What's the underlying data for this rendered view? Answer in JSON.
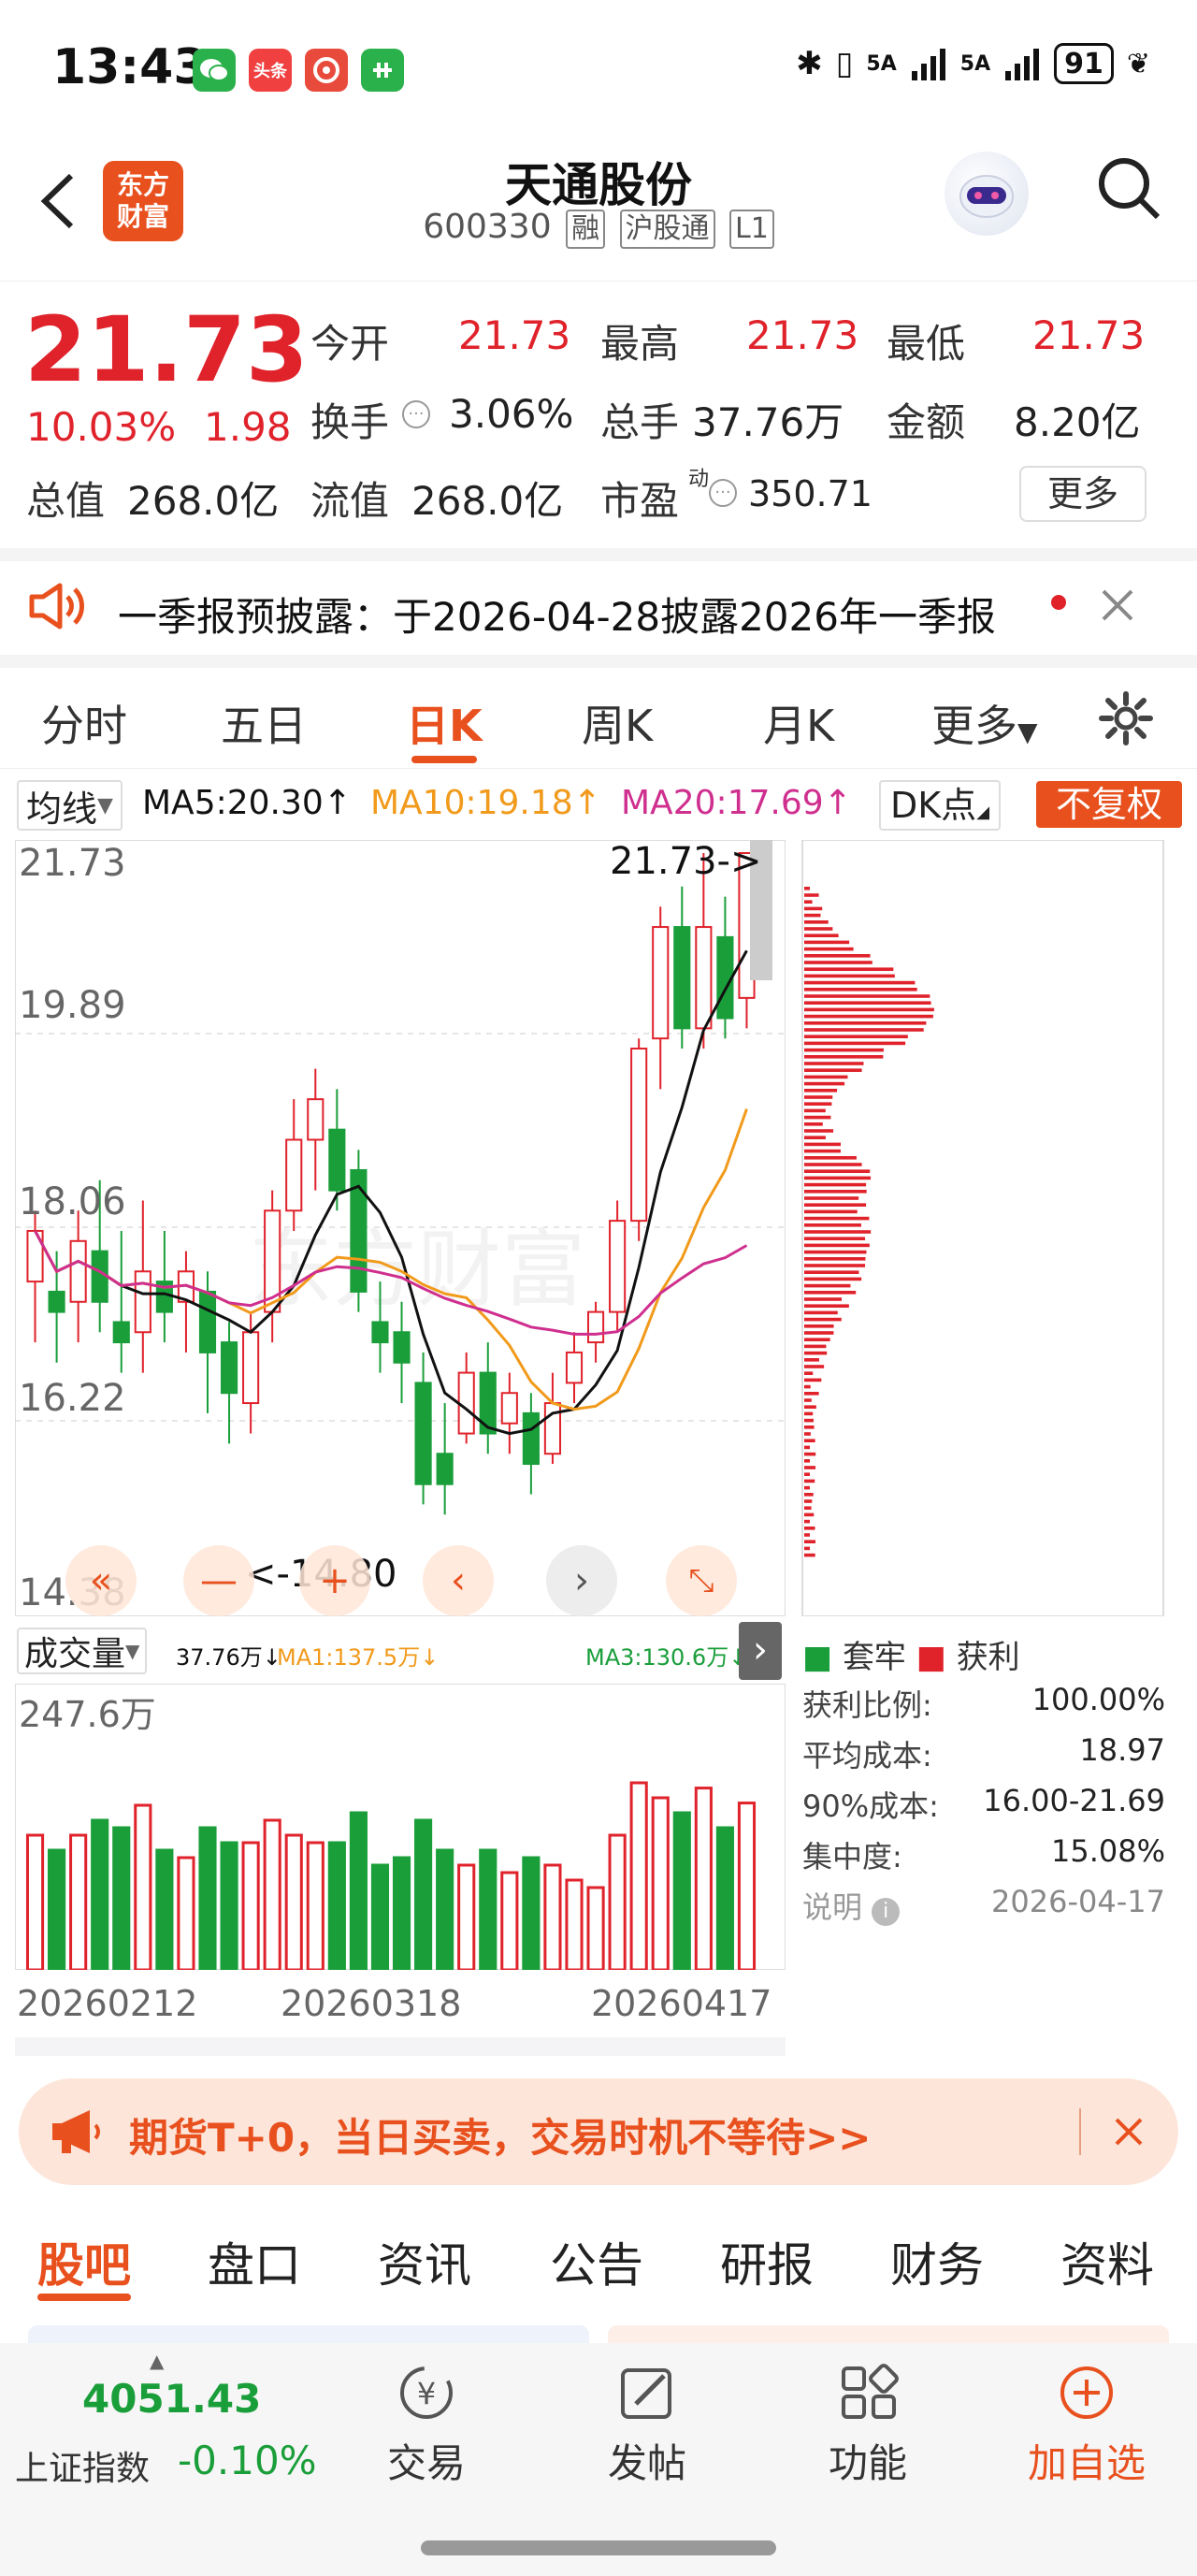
{
  "status": {
    "time": "13:43",
    "app_icons": [
      "wechat-icon",
      "toutiao-icon",
      "app-icon",
      "app-icon-2"
    ],
    "toutiao_text": "头条",
    "battery": "91",
    "signal1": "5A",
    "signal2": "5A"
  },
  "header": {
    "logo_text_line1": "东方",
    "logo_text_line2": "财富",
    "stock_name": "天通股份",
    "stock_code": "600330",
    "tag_rong": "融",
    "tag_hgt": "沪股通",
    "tag_l1": "L1"
  },
  "quote": {
    "price": "21.73",
    "change_pct": "10.03%",
    "change_amt": "1.98",
    "open_label": "今开",
    "open": "21.73",
    "high_label": "最高",
    "high": "21.73",
    "low_label": "最低",
    "low": "21.73",
    "turnover_label": "换手",
    "turnover": "3.06%",
    "volume_label": "总手",
    "volume": "37.76万",
    "amount_label": "金额",
    "amount": "8.20亿",
    "total_mv_label": "总值",
    "total_mv": "268.0亿",
    "float_mv_label": "流值",
    "float_mv": "268.0亿",
    "pe_label": "市盈",
    "pe_sup": "动",
    "pe": "350.71",
    "more_button": "更多"
  },
  "notice": {
    "text": "一季报预披露：于2026-04-28披露2026年一季报"
  },
  "tabs": [
    "分时",
    "五日",
    "日K",
    "周K",
    "月K",
    "更多"
  ],
  "active_tab": "日K",
  "ma_legend": {
    "ma_select": "均线",
    "ma5": "MA5:20.30",
    "ma10": "MA10:19.18",
    "ma20": "MA20:17.69",
    "dk": "DK点",
    "fuquan": "不复权"
  },
  "chart_labels": {
    "y1": "21.73",
    "y2": "19.89",
    "y3": "18.06",
    "y4": "16.22",
    "y5": "14.38",
    "last_price_marker": "21.73->",
    "min_marker": "<-14.80"
  },
  "volume_legend": {
    "select": "成交量",
    "vol": "37.76万",
    "ma1": "MA1:137.5万",
    "ma3": "MA3:130.6万",
    "ymax": "247.6万"
  },
  "dates": [
    "20260212",
    "20260318",
    "20260417"
  ],
  "chip": {
    "legend_trapped": "套牢",
    "legend_profit": "获利",
    "profit_ratio_label": "获利比例:",
    "profit_ratio": "100.00%",
    "avg_cost_label": "平均成本:",
    "avg_cost": "18.97",
    "cost90_label": "90%成本:",
    "cost90": "16.00-21.69",
    "concentration_label": "集中度:",
    "concentration": "15.08%",
    "explain_label": "说明",
    "date": "2026-04-17"
  },
  "promo": {
    "text": "期货T+0，当日买卖，交易时机不等待>>"
  },
  "bottom_tabs": [
    "股吧",
    "盘口",
    "资讯",
    "公告",
    "研报",
    "财务",
    "资料"
  ],
  "active_bottom_tab": "股吧",
  "bottom_bar": {
    "index_value": "4051.43",
    "index_name": "上证指数",
    "index_change": "-0.10%",
    "trade": "交易",
    "post": "发帖",
    "func": "功能",
    "add": "加自选"
  },
  "chart_data": {
    "type": "candlestick",
    "ylim": [
      14.38,
      21.73
    ],
    "y_ticks": [
      21.73,
      19.89,
      18.06,
      16.22,
      14.38
    ],
    "candles": [
      [
        17.5,
        18.0,
        17.0,
        16.9,
        18.2
      ],
      [
        17.4,
        17.2,
        16.8,
        16.7,
        17.8
      ],
      [
        17.3,
        17.9,
        17.2,
        16.9,
        18.2
      ],
      [
        17.8,
        17.3,
        17.5,
        17.0,
        18.5
      ],
      [
        17.1,
        16.9,
        17.5,
        16.6,
        18.0
      ],
      [
        17.0,
        17.6,
        16.9,
        16.6,
        18.3
      ],
      [
        17.5,
        17.2,
        17.6,
        16.9,
        18.0
      ],
      [
        17.3,
        17.6,
        17.0,
        16.8,
        17.8
      ],
      [
        17.4,
        16.8,
        16.7,
        16.2,
        17.6
      ],
      [
        16.9,
        16.4,
        16.5,
        15.9,
        17.1
      ],
      [
        16.3,
        17.0,
        16.4,
        16.0,
        17.2
      ],
      [
        17.2,
        18.2,
        17.0,
        16.9,
        18.4
      ],
      [
        18.2,
        18.9,
        18.4,
        18.0,
        19.3
      ],
      [
        18.9,
        19.3,
        18.7,
        18.4,
        19.6
      ],
      [
        19.0,
        18.4,
        18.6,
        18.2,
        19.4
      ],
      [
        18.6,
        17.4,
        18.2,
        17.2,
        18.8
      ],
      [
        17.1,
        16.9,
        17.0,
        16.6,
        17.5
      ],
      [
        17.0,
        16.7,
        16.5,
        16.3,
        17.3
      ],
      [
        16.5,
        15.5,
        16.0,
        15.3,
        16.8
      ],
      [
        15.8,
        15.5,
        15.9,
        15.2,
        16.3
      ],
      [
        16.0,
        16.6,
        16.2,
        15.9,
        16.8
      ],
      [
        16.6,
        16.0,
        16.4,
        15.8,
        16.9
      ],
      [
        16.1,
        16.4,
        16.3,
        15.8,
        16.6
      ],
      [
        16.2,
        15.7,
        16.0,
        15.4,
        16.4
      ],
      [
        15.8,
        16.3,
        16.2,
        15.7,
        16.6
      ],
      [
        16.5,
        16.8,
        16.6,
        16.3,
        17.0
      ],
      [
        16.9,
        17.2,
        17.1,
        16.7,
        17.3
      ],
      [
        17.2,
        18.1,
        17.0,
        17.0,
        18.3
      ],
      [
        18.1,
        19.8,
        18.0,
        17.9,
        19.9
      ],
      [
        19.9,
        21.0,
        19.8,
        19.4,
        21.2
      ],
      [
        21.0,
        20.0,
        20.2,
        19.8,
        21.4
      ],
      [
        20.0,
        21.0,
        19.9,
        19.8,
        21.73
      ],
      [
        20.9,
        20.1,
        20.0,
        19.9,
        21.3
      ],
      [
        20.3,
        21.73,
        20.1,
        20.0,
        21.73
      ]
    ],
    "ma5_label": "MA5:20.30",
    "ma10_label": "MA10:19.18",
    "ma20_label": "MA20:17.69"
  }
}
